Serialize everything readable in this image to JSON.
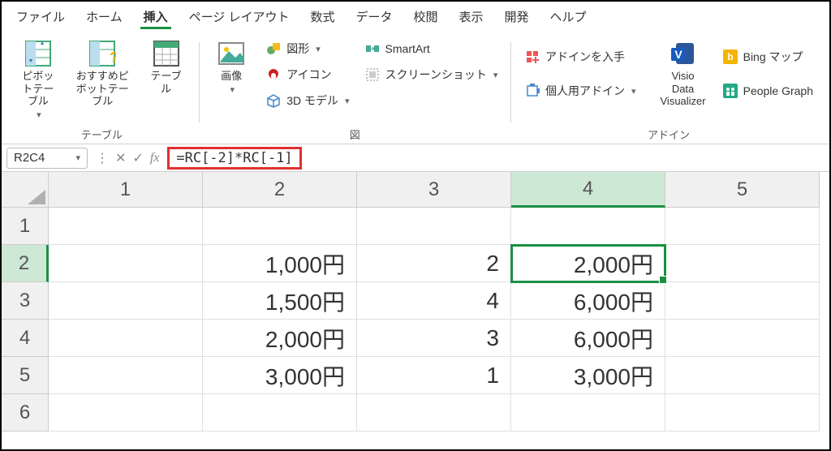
{
  "menu": [
    "ファイル",
    "ホーム",
    "挿入",
    "ページ レイアウト",
    "数式",
    "データ",
    "校閲",
    "表示",
    "開発",
    "ヘルプ"
  ],
  "menu_active": 2,
  "ribbon": {
    "tables": {
      "pivot": "ピボットテーブル",
      "recommended": "おすすめピボットテーブル",
      "table": "テーブル",
      "group": "テーブル"
    },
    "illust": {
      "pictures": "画像",
      "shapes": "図形",
      "icons": "アイコン",
      "models": "3D モデル",
      "smartart": "SmartArt",
      "screenshot": "スクリーンショット",
      "group": "図"
    },
    "addins": {
      "get": "アドインを入手",
      "my": "個人用アドイン",
      "visio": "Visio Data Visualizer",
      "bing": "Bing マップ",
      "people": "People Graph",
      "group": "アドイン"
    }
  },
  "formula_bar": {
    "name": "R2C4",
    "formula": "=RC[-2]*RC[-1]"
  },
  "cols": [
    "1",
    "2",
    "3",
    "4",
    "5"
  ],
  "rows": [
    "1",
    "2",
    "3",
    "4",
    "5",
    "6"
  ],
  "cells": {
    "r2": {
      "c2": "1,000円",
      "c3": "2",
      "c4": "2,000円"
    },
    "r3": {
      "c2": "1,500円",
      "c3": "4",
      "c4": "6,000円"
    },
    "r4": {
      "c2": "2,000円",
      "c3": "3",
      "c4": "6,000円"
    },
    "r5": {
      "c2": "3,000円",
      "c3": "1",
      "c4": "3,000円"
    }
  },
  "active": {
    "row": 2,
    "col": 4
  }
}
